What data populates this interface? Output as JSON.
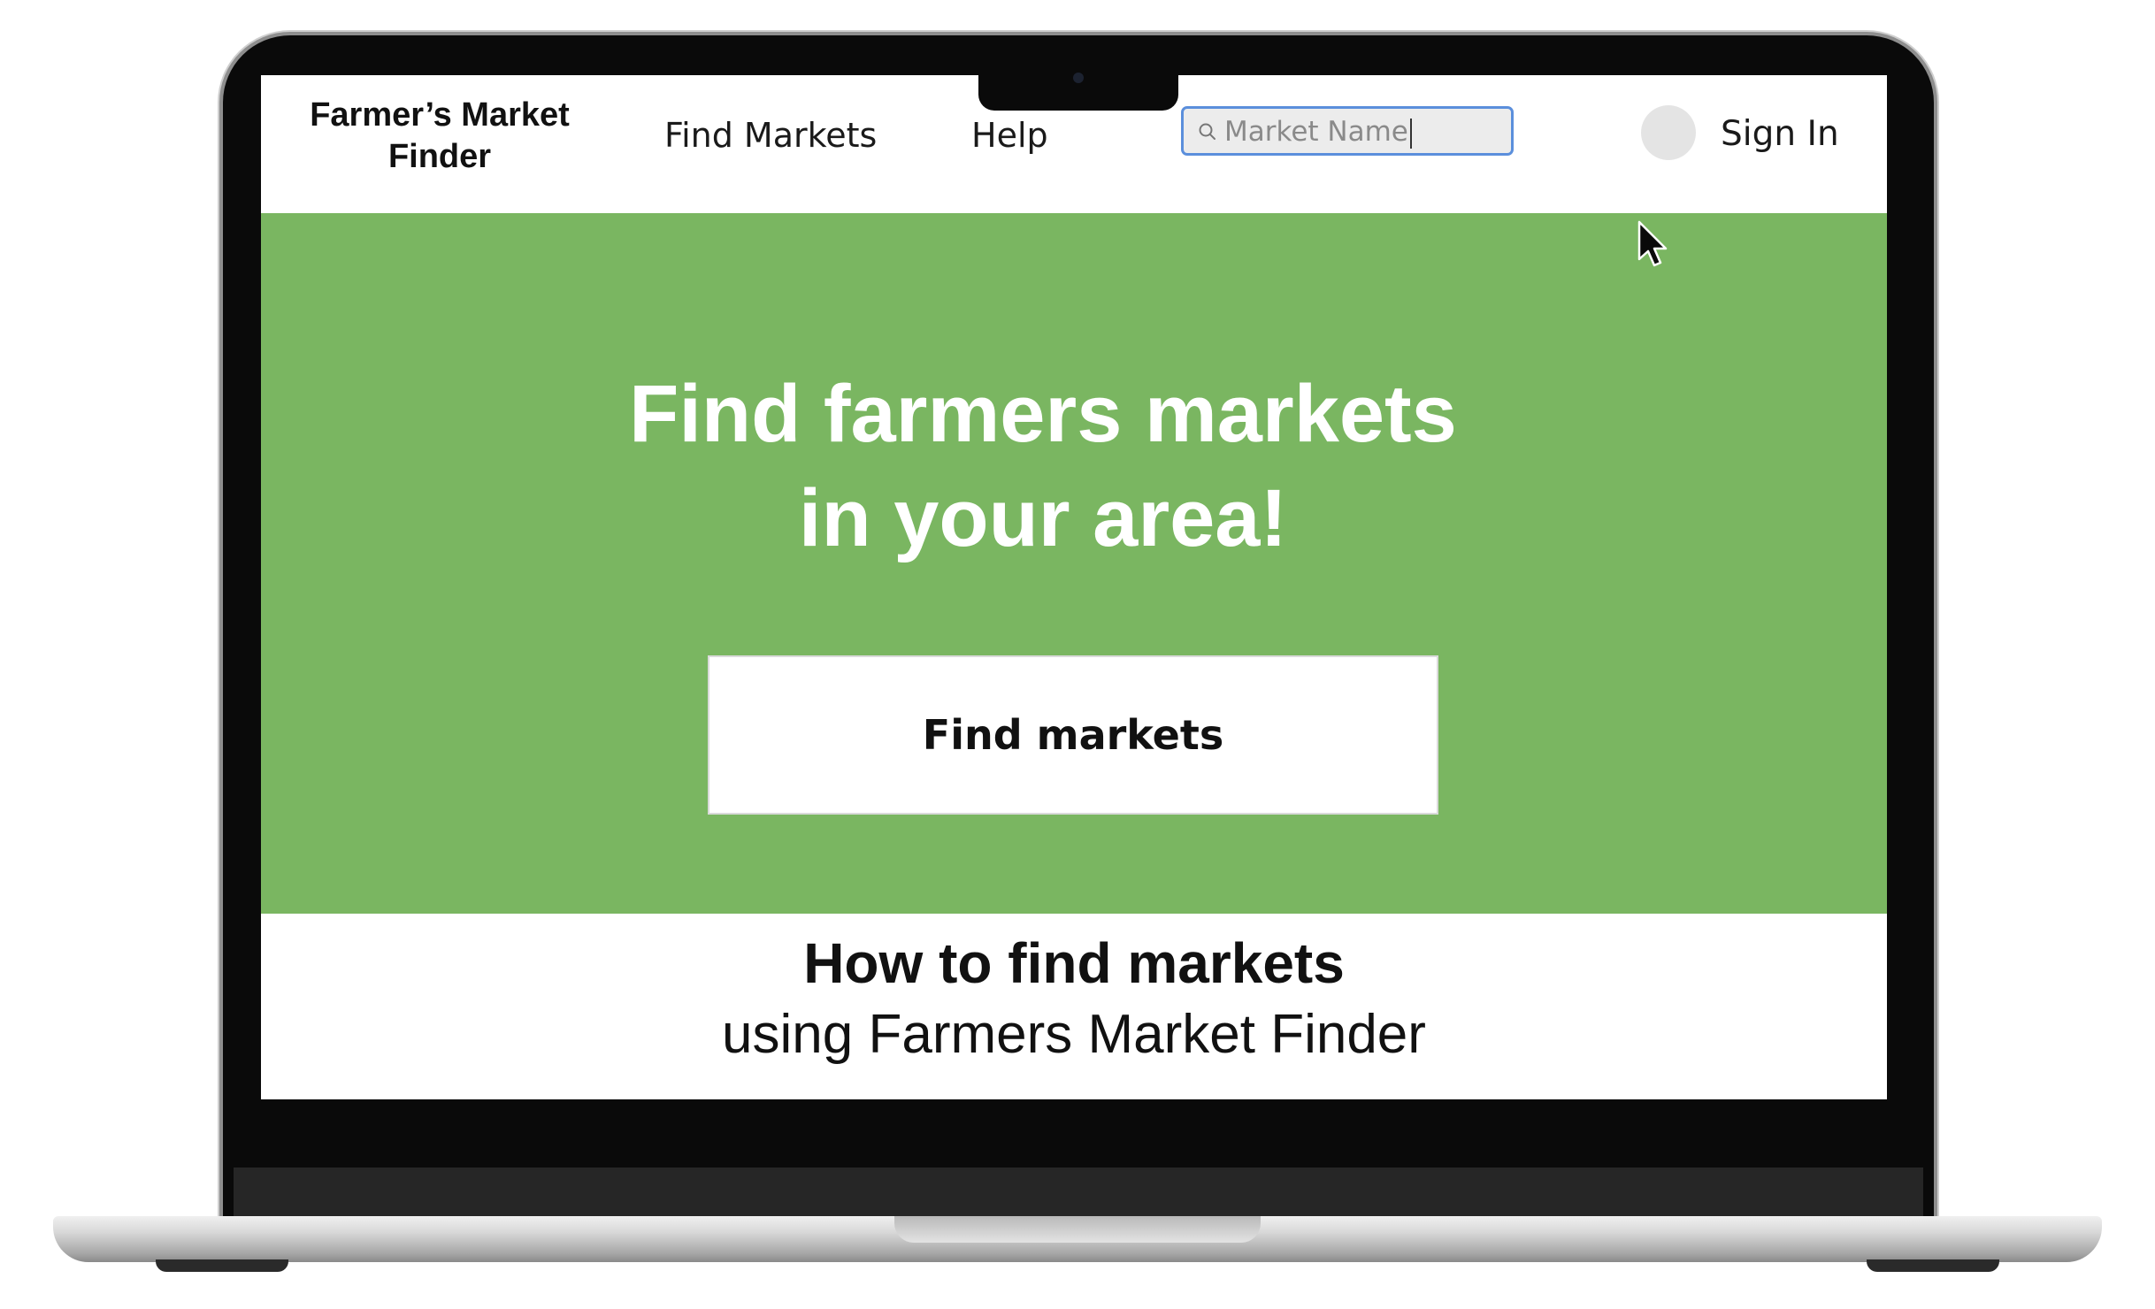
{
  "navbar": {
    "brand": "Farmer’s Market\nFinder",
    "links": [
      {
        "label": "Find Markets"
      },
      {
        "label": "Help"
      }
    ],
    "search": {
      "value": "Market Name",
      "icon": "search-icon"
    },
    "sign_in": "Sign In"
  },
  "hero": {
    "title_line1": "Find farmers markets",
    "title_line2": "in your area!",
    "button_label": "Find markets",
    "background_color": "#7ab661"
  },
  "howto": {
    "title": "How to find markets",
    "subtitle": "using Farmers Market Finder"
  }
}
